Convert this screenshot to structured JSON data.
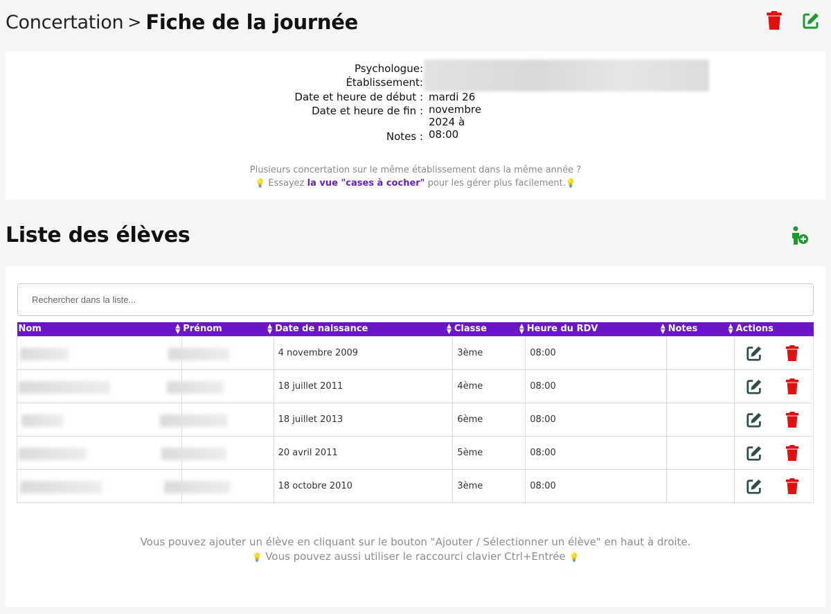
{
  "header": {
    "breadcrumb_parent": "Concertation",
    "breadcrumb_sep": ">",
    "title": "Fiche de la journée"
  },
  "details": {
    "psychologue_label": "Psychologue:",
    "etablissement_label": "Établissement:",
    "debut_label": "Date et heure de début :",
    "debut_value": "mardi 26 novembre 2024 à 08:00",
    "fin_label": "Date et heure de fin :",
    "notes_label": "Notes :"
  },
  "hint": {
    "line1": "Plusieurs concertation sur le même établissement dans la même année ?",
    "line2_before": "Essayez",
    "line2_link": "la vue \"cases à cocher\"",
    "line2_after": "pour les gérer plus facilement."
  },
  "students": {
    "title": "Liste des élèves",
    "search_placeholder": "Rechercher dans la liste...",
    "columns": [
      "Nom",
      "Prénom",
      "Date de naissance",
      "Classe",
      "Heure du RDV",
      "Notes",
      "Actions"
    ],
    "rows": [
      {
        "naissance": "4 novembre 2009",
        "classe": "3ème",
        "heure": "08:00",
        "notes": ""
      },
      {
        "naissance": "18 juillet 2011",
        "classe": "4ème",
        "heure": "08:00",
        "notes": ""
      },
      {
        "naissance": "18 juillet 2013",
        "classe": "6ème",
        "heure": "08:00",
        "notes": ""
      },
      {
        "naissance": "20 avril 2011",
        "classe": "5ème",
        "heure": "08:00",
        "notes": ""
      },
      {
        "naissance": "18 octobre 2010",
        "classe": "3ème",
        "heure": "08:00",
        "notes": ""
      }
    ]
  },
  "footer": {
    "line1": "Vous pouvez ajouter un élève en cliquant sur le bouton \"Ajouter / Sélectionner un élève\" en haut à droite.",
    "line2": "Vous pouvez aussi utiliser le raccourci clavier Ctrl+Entrée"
  },
  "icons": {
    "delete": "trash-icon",
    "edit": "edit-icon",
    "add_student": "user-plus-icon",
    "hint": "lightbulb-icon"
  },
  "colors": {
    "accent": "#6b14c9",
    "delete": "#e01010",
    "edit_header": "#1f9a2e",
    "edit_row": "#2f4f4f",
    "link": "#6a1fc4"
  }
}
